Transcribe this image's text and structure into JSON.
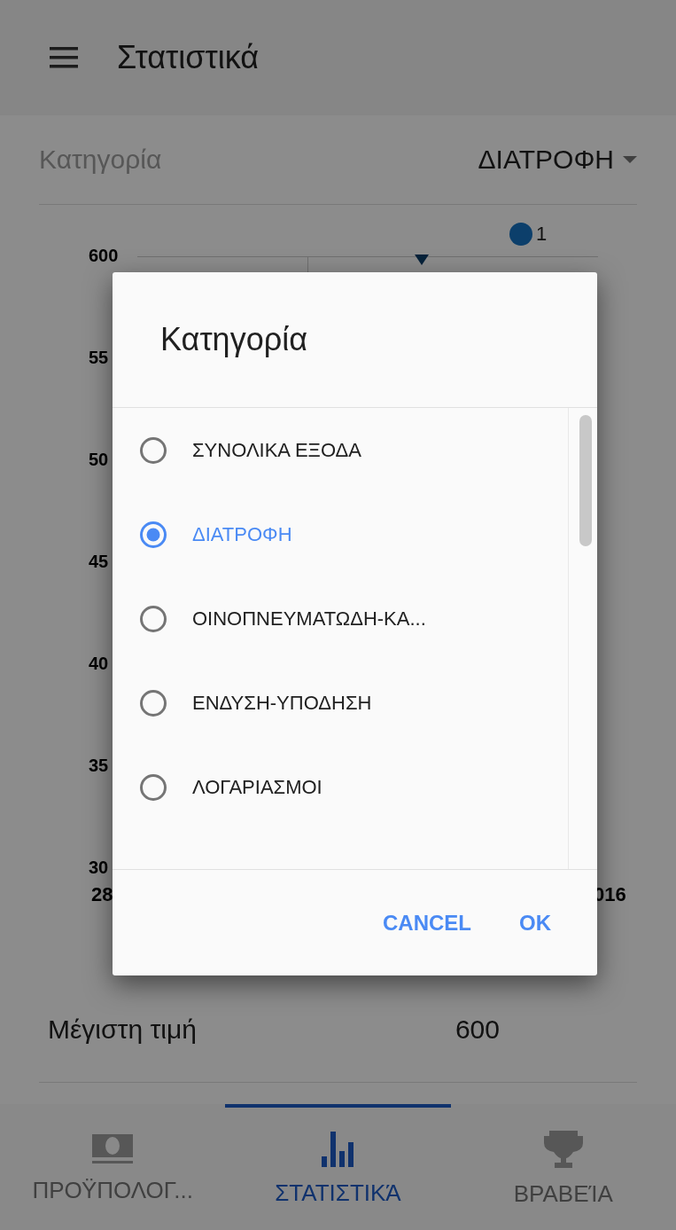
{
  "app_bar": {
    "title": "Στατιστικά"
  },
  "category_filter": {
    "label": "Κατηγορία",
    "value": "ΔΙΑΤΡΟΦΗ"
  },
  "chart": {
    "legend": {
      "label": "1",
      "color": "#0c3f6b"
    },
    "y_labels": [
      "600",
      "55",
      "50",
      "45",
      "40",
      "35",
      "30"
    ],
    "x_labels": [
      "28",
      "016"
    ]
  },
  "summary": {
    "label": "Μέγιστη τιμή",
    "value": "600"
  },
  "bottom_nav": [
    {
      "label": "ΠΡΟΫΠΟΛΟΓ...",
      "kind": "money",
      "selected": false
    },
    {
      "label": "ΣΤΑΤΙΣΤΙΚΆ",
      "kind": "chart",
      "selected": true
    },
    {
      "label": "ΒΡΑΒΕΊΑ",
      "kind": "trophy",
      "selected": false
    }
  ],
  "dialog": {
    "title": "Κατηγορία",
    "options": [
      {
        "label": "ΣΥΝΟΛΙΚΑ ΕΞΟΔΑ",
        "selected": false
      },
      {
        "label": "ΔΙΑΤΡΟΦΗ",
        "selected": true
      },
      {
        "label": "ΟΙΝΟΠΝΕΥΜΑΤΩΔΗ-ΚΑ...",
        "selected": false
      },
      {
        "label": "ΕΝΔΥΣΗ-ΥΠΟΔΗΣΗ",
        "selected": false
      },
      {
        "label": "ΛΟΓΑΡΙΑΣΜΟΙ",
        "selected": false
      }
    ],
    "buttons": [
      "CANCEL",
      "OK"
    ]
  }
}
